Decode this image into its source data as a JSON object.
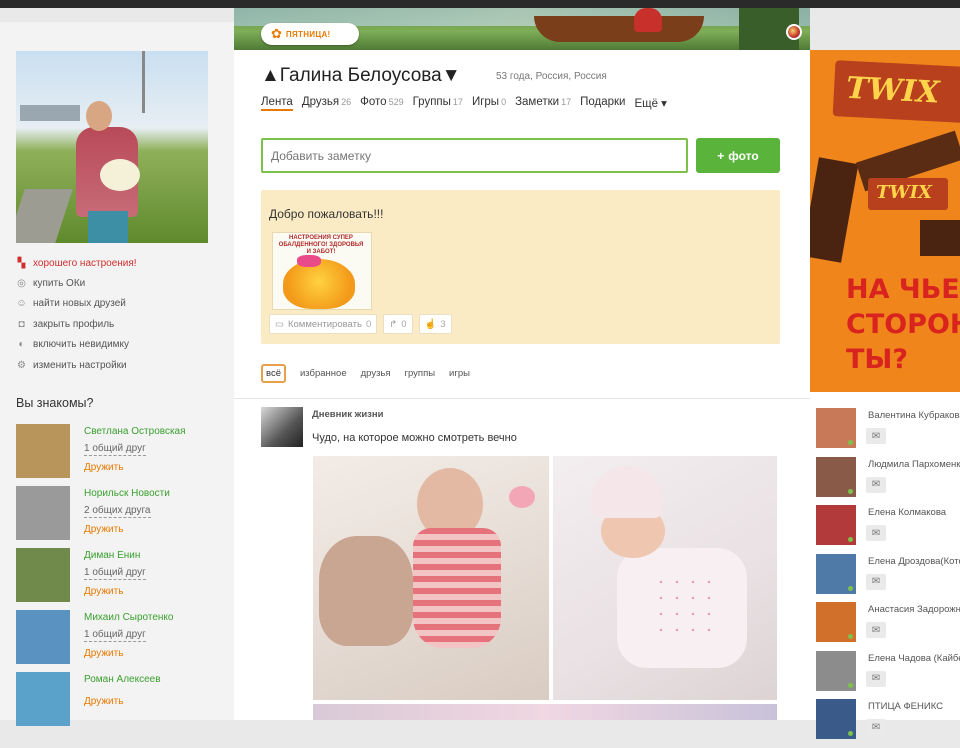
{
  "colors": {
    "brand_orange": "#e87a00",
    "green_accent": "#5ab33b",
    "link_green": "#3aa02f",
    "welcome_bg": "#faebc4",
    "alert_red": "#d12d2d"
  },
  "banner": {
    "friday_label": "ПЯТНИЦА!",
    "friday_icon": "✿"
  },
  "profile": {
    "name": "▲Галина Белоусова▼",
    "meta": "53 года, Россия, Россия"
  },
  "tabs": [
    {
      "label": "Лента",
      "count": ""
    },
    {
      "label": "Друзья",
      "count": "26"
    },
    {
      "label": "Фото",
      "count": "529"
    },
    {
      "label": "Группы",
      "count": "17"
    },
    {
      "label": "Игры",
      "count": "0"
    },
    {
      "label": "Заметки",
      "count": "17"
    },
    {
      "label": "Подарки",
      "count": ""
    },
    {
      "label": "Ещё ▾",
      "count": ""
    }
  ],
  "note": {
    "placeholder": "Добавить заметку",
    "photo_button": "фото",
    "photo_button_icon": "+"
  },
  "welcome": {
    "text": "Добро пожаловать!!!",
    "image_caption": "НАСТРОЕНИЯ СУПЕР ОБАЛДЕННОГО! ЗДОРОВЬЯ И ЗАБОТ!",
    "comment_label": "Комментировать",
    "comment_count": "0",
    "share_count": "0",
    "like_count": "3"
  },
  "left_menu": [
    {
      "icon": "gift-icon",
      "glyph": "▚",
      "label": "хорошего настроения!",
      "red": true
    },
    {
      "icon": "ok-coin-icon",
      "glyph": "◎",
      "label": "купить ОКи",
      "red": false
    },
    {
      "icon": "person-icon",
      "glyph": "☺",
      "label": "найти новых друзей",
      "red": false
    },
    {
      "icon": "lock-icon",
      "glyph": "◘",
      "label": "закрыть профиль",
      "red": false
    },
    {
      "icon": "invisible-icon",
      "glyph": "◐",
      "label": "включить невидимку",
      "red": false
    },
    {
      "icon": "gear-icon",
      "glyph": "⚙",
      "label": "изменить настройки",
      "red": false
    }
  ],
  "pymk": {
    "title": "Вы знакомы?",
    "add_label": "Дружить",
    "people": [
      {
        "name": "Светлана Островская",
        "mutual": "1 общий друг",
        "thumb": "#b8955a"
      },
      {
        "name": "Норильск Новости",
        "mutual": "2 общих друга",
        "thumb": "#9a9a9a"
      },
      {
        "name": "Диман Енин",
        "mutual": "1 общий друг",
        "thumb": "#6f8a4a"
      },
      {
        "name": "Михаил Сыротенко",
        "mutual": "1 общий друг",
        "thumb": "#5a93c2"
      },
      {
        "name": "Роман Алексеев",
        "mutual": "",
        "thumb": "#5aa2c9"
      }
    ]
  },
  "feed": {
    "filters": [
      "всё",
      "избранное",
      "друзья",
      "группы",
      "игры"
    ],
    "active_filter": "всё",
    "post_author": "Дневник жизни",
    "post_text": "Чудо, на которое можно смотреть вечно"
  },
  "ad": {
    "brand": "TWIX",
    "slogan_lines": [
      "НА ЧЬЕЙ",
      "СТОРОН",
      "ТЫ?"
    ]
  },
  "online_friends": [
    {
      "name": "Валентина Кубракова",
      "photo": "#c87a58"
    },
    {
      "name": "Людмила Пархоменко",
      "photo": "#8a5a48"
    },
    {
      "name": "Елена Колмакова",
      "photo": "#b23a3a"
    },
    {
      "name": "Елена Дроздова(Котова)",
      "photo": "#4f7aa8"
    },
    {
      "name": "Анастасия Задорожная",
      "photo": "#d0702a"
    },
    {
      "name": "Елена Чадова (Кайбелова)",
      "photo": "#8c8c8c"
    },
    {
      "name": "ПТИЦА ФЕНИКС",
      "photo": "#3a5a8a"
    }
  ],
  "message_icon": "✉"
}
